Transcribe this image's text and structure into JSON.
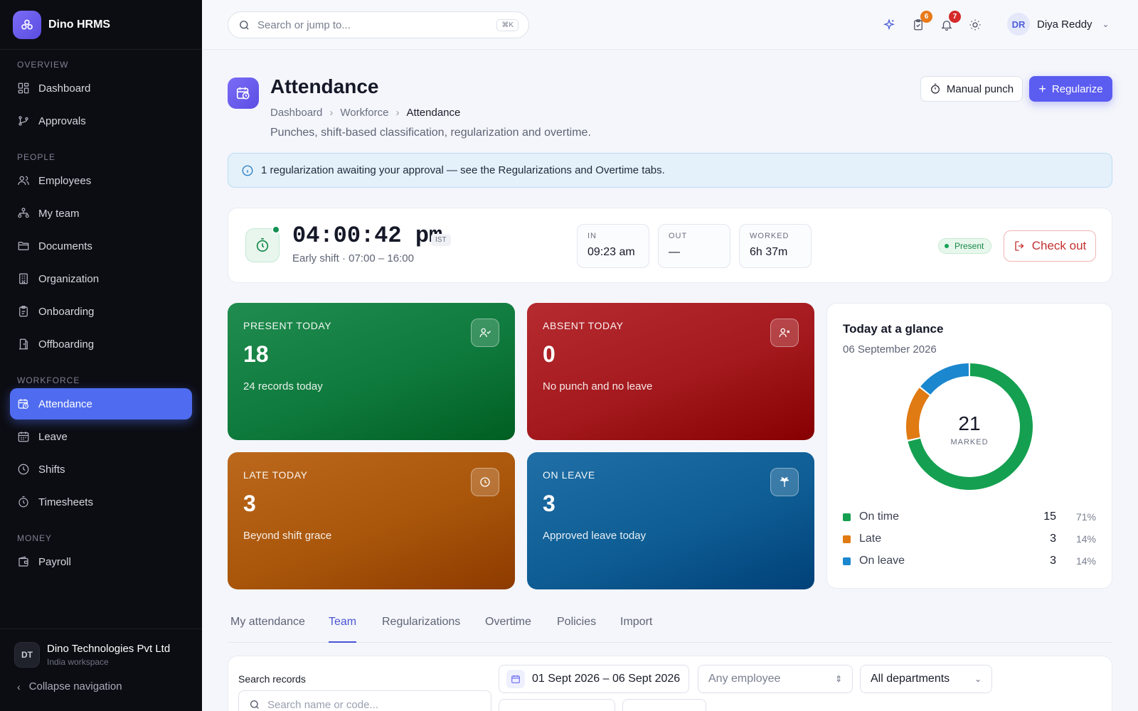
{
  "brand": {
    "name": "Dino HRMS"
  },
  "sidebar": {
    "sections": {
      "overview": "OVERVIEW",
      "people": "PEOPLE",
      "workforce": "WORKFORCE",
      "money": "MONEY"
    },
    "items": {
      "dashboard": "Dashboard",
      "approvals": "Approvals",
      "employees": "Employees",
      "my_team": "My team",
      "documents": "Documents",
      "organization": "Organization",
      "onboarding": "Onboarding",
      "offboarding": "Offboarding",
      "attendance": "Attendance",
      "leave": "Leave",
      "shifts": "Shifts",
      "timesheets": "Timesheets",
      "payroll": "Payroll"
    },
    "active_item": "Attendance",
    "org": {
      "initials": "DT",
      "name": "Dino Technologies Pvt Ltd",
      "sub": "India workspace"
    },
    "collapse_label": "Collapse navigation"
  },
  "topbar": {
    "search_placeholder": "Search or jump to...",
    "shortcut": "⌘K",
    "tasks_badge": "6",
    "notifications_badge": "7",
    "user": {
      "initials": "DR",
      "name": "Diya Reddy"
    }
  },
  "page": {
    "title": "Attendance",
    "breadcrumb": [
      "Dashboard",
      "Workforce",
      "Attendance"
    ],
    "subtitle": "Punches, shift-based classification, regularization and overtime.",
    "manual_punch_label": "Manual punch",
    "regularize_label": "Regularize"
  },
  "alert": {
    "text": "1 regularization awaiting your approval — see the Regularizations and Overtime tabs."
  },
  "clock": {
    "time": "04:00:42 pm",
    "timezone": "IST",
    "shift": "Early shift · 07:00 – 16:00",
    "in_label": "IN",
    "in_value": "09:23 am",
    "out_label": "OUT",
    "out_value": "—",
    "worked_label": "WORKED",
    "worked_value": "6h 37m",
    "status": "Present",
    "checkout_label": "Check out"
  },
  "tiles": {
    "present": {
      "label": "PRESENT TODAY",
      "value": "18",
      "sub": "24 records today",
      "color": "#0f7a3d"
    },
    "absent": {
      "label": "ABSENT TODAY",
      "value": "0",
      "sub": "No punch and no leave",
      "color": "#a3191d"
    },
    "late": {
      "label": "LATE TODAY",
      "value": "3",
      "sub": "Beyond shift grace",
      "color": "#a9560b"
    },
    "leave": {
      "label": "ON LEAVE",
      "value": "3",
      "sub": "Approved leave today",
      "color": "#0e5d94"
    }
  },
  "glance": {
    "title": "Today at a glance",
    "date": "06 September 2026",
    "center_value": "21",
    "center_label": "MARKED",
    "legend": [
      {
        "name": "On time",
        "count": "15",
        "pct": "71%",
        "value": 15,
        "color": "#14a050"
      },
      {
        "name": "Late",
        "count": "3",
        "pct": "14%",
        "value": 3,
        "color": "#e07a12"
      },
      {
        "name": "On leave",
        "count": "3",
        "pct": "14%",
        "value": 3,
        "color": "#1b87cf"
      }
    ]
  },
  "tabs": [
    "My attendance",
    "Team",
    "Regularizations",
    "Overtime",
    "Policies",
    "Import"
  ],
  "active_tab": "Team",
  "filters": {
    "search_label": "Search records",
    "search_placeholder": "Search name or code...",
    "date_range": "01 Sept 2026 – 06 Sept 2026",
    "employee_placeholder": "Any employee",
    "department": "All departments"
  }
}
